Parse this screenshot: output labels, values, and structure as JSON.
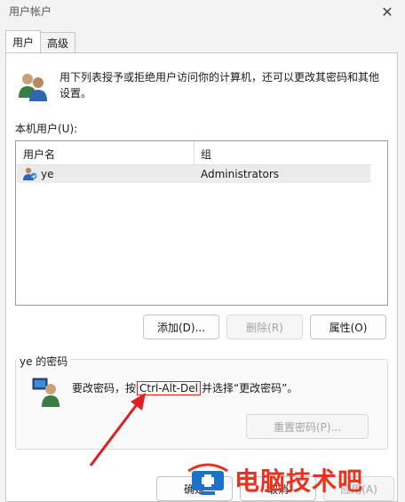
{
  "window": {
    "title": "用户帐户",
    "close_glyph": "✕"
  },
  "tabs": [
    {
      "label": "用户"
    },
    {
      "label": "高级"
    }
  ],
  "intro_text": "用下列表授予或拒绝用户访问你的计算机，还可以更改其密码和其他设置。",
  "local_users": {
    "label": "本机用户(U):",
    "columns": [
      "用户名",
      "组"
    ],
    "rows": [
      {
        "name": "ye",
        "group": "Administrators"
      }
    ]
  },
  "buttons": {
    "add": "添加(D)...",
    "delete": "删除(R)",
    "properties": "属性(O)",
    "reset_password": "重置密码(P)...",
    "ok": "确定",
    "cancel": "取消",
    "apply": "应用(A)"
  },
  "password_section": {
    "title": "ye 的密码",
    "text_before": "要改密码，按",
    "key_combo": "Ctrl-Alt-Del",
    "text_after": "并选择“更改密码”。"
  },
  "watermark": {
    "text": "电脑技术吧"
  },
  "colors": {
    "annotation": "#e02020",
    "watermark": "#e8321e",
    "watermark_logo": "#1a73c8"
  }
}
